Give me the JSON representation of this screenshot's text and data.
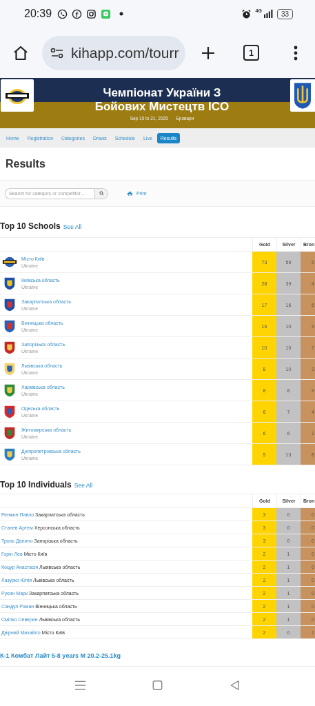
{
  "status_bar": {
    "time": "20:39",
    "network": "4G",
    "battery": "33"
  },
  "browser": {
    "url": "kihapp.com/tourr",
    "tab_count": "1"
  },
  "banner": {
    "title_lines": [
      "Чемпіонат України З",
      "Бойових Мистецтв ICO"
    ],
    "dates": "Sep 19 to 21, 2025",
    "location": "Бровари"
  },
  "nav": [
    {
      "label": "Home",
      "selected": false
    },
    {
      "label": "Registration",
      "selected": false
    },
    {
      "label": "Categories",
      "selected": false
    },
    {
      "label": "Draws",
      "selected": false
    },
    {
      "label": "Schedule",
      "selected": false
    },
    {
      "label": "Live",
      "selected": false
    },
    {
      "label": "Results",
      "selected": true
    }
  ],
  "page_title": "Results",
  "search": {
    "placeholder": "Search for category or competitor...",
    "print": "Print"
  },
  "schools": {
    "title": "Top 10 Schools",
    "see_all": "See All",
    "columns": [
      "Gold",
      "Silver",
      "Bron"
    ],
    "rows": [
      {
        "kind": "logo",
        "name": "Місто Київ",
        "country": "Ukraine",
        "gold": "73",
        "silver": "59",
        "bronze": "5"
      },
      {
        "kind": "crest",
        "name": "Київська область",
        "country": "Ukraine",
        "gold": "28",
        "silver": "39",
        "bronze": "4"
      },
      {
        "kind": "crest",
        "name": "Закарпатська область",
        "country": "Ukraine",
        "gold": "17",
        "silver": "16",
        "bronze": "5"
      },
      {
        "kind": "crest",
        "name": "Вінницька область",
        "country": "Ukraine",
        "gold": "16",
        "silver": "10",
        "bronze": "3"
      },
      {
        "kind": "crest",
        "name": "Запорізька область",
        "country": "Ukraine",
        "gold": "10",
        "silver": "10",
        "bronze": "7"
      },
      {
        "kind": "crest",
        "name": "Львівська область",
        "country": "Ukraine",
        "gold": "8",
        "silver": "10",
        "bronze": "3"
      },
      {
        "kind": "crest",
        "name": "Харківська область",
        "country": "Ukraine",
        "gold": "8",
        "silver": "8",
        "bronze": "9"
      },
      {
        "kind": "crest",
        "name": "Одеська область",
        "country": "Ukraine",
        "gold": "6",
        "silver": "7",
        "bronze": "4"
      },
      {
        "kind": "crest",
        "name": "Житомирська область",
        "country": "Ukraine",
        "gold": "6",
        "silver": "6",
        "bronze": "1"
      },
      {
        "kind": "crest",
        "name": "Дніпропетровська область",
        "country": "Ukraine",
        "gold": "5",
        "silver": "13",
        "bronze": "8"
      }
    ]
  },
  "individuals": {
    "title": "Top 10 Individuals",
    "see_all": "See All",
    "columns": [
      "Gold",
      "Silver",
      "Bron"
    ],
    "rows": [
      {
        "name": "Ренжин Павло",
        "region": "Закарпатська область",
        "gold": "3",
        "silver": "0",
        "bronze": "0"
      },
      {
        "name": "Станев Артем",
        "region": "Херсонська область",
        "gold": "3",
        "silver": "0",
        "bronze": "0"
      },
      {
        "name": "Тронь Данило",
        "region": "Запорізька область",
        "gold": "3",
        "silver": "0",
        "bronze": "0"
      },
      {
        "name": "Горін Лев",
        "region": "Місто Київ",
        "gold": "2",
        "silver": "1",
        "bronze": "0"
      },
      {
        "name": "Коцур Анастасія",
        "region": "Львівська область",
        "gold": "2",
        "silver": "1",
        "bronze": "0"
      },
      {
        "name": "Лазурко Юлія",
        "region": "Львівська область",
        "gold": "2",
        "silver": "1",
        "bronze": "0"
      },
      {
        "name": "Русин Марк",
        "region": "Закарпатська область",
        "gold": "2",
        "silver": "1",
        "bronze": "0"
      },
      {
        "name": "Сандул Роман",
        "region": "Вінницька область",
        "gold": "2",
        "silver": "1",
        "bronze": "0"
      },
      {
        "name": "Смілко Северин",
        "region": "Львівська область",
        "gold": "2",
        "silver": "1",
        "bronze": "0"
      },
      {
        "name": "Двірний Михайло",
        "region": "Місто Київ",
        "gold": "2",
        "silver": "0",
        "bronze": "1"
      }
    ]
  },
  "category_title": "К-1 Комбат Лайт 5-8 years M 20.2-25.1kg"
}
